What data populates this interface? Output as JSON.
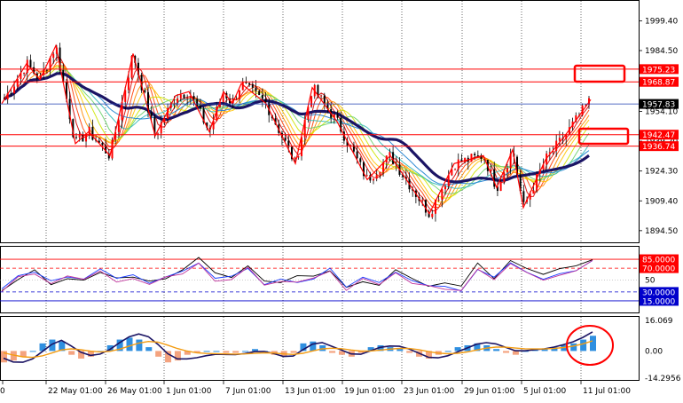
{
  "colors": {
    "bg": "#ffffff",
    "frame": "#000000",
    "grid": "#000000",
    "candle": "#000000",
    "bull_candle": "#ff0000",
    "zigzag": "#ff0000",
    "hline": "#ff0000",
    "bid_line": "#1f3fb0",
    "sma_heavy": "#1b1464",
    "fan": [
      "#d60000",
      "#ff3b00",
      "#ff8a00",
      "#ffc400",
      "#cde600",
      "#6ad06a",
      "#2fb8b8",
      "#1b7fd0"
    ],
    "osc_black": "#000000",
    "osc_blue": "#1a3cff",
    "osc_magenta": "#c0329b",
    "level_red": "#ff0000",
    "level_blue": "#0000cc",
    "hist_pos": "#2f8fe0",
    "hist_neg": "#f4a37f",
    "macd_line": "#1b1464",
    "signal_line": "#f39c12",
    "annot": "#ff0000"
  },
  "price_panel": {
    "axis_labels": [
      "1999.40",
      "1984.50",
      "1954.10",
      "1939.20",
      "1924.30",
      "1909.40",
      "1894.50"
    ],
    "axis_values": [
      1999.4,
      1984.5,
      1954.1,
      1939.2,
      1924.3,
      1909.4,
      1894.5
    ],
    "ylim": [
      1890.0,
      2008.0
    ],
    "current_price": "1957.83",
    "levels": [
      {
        "label": "1975.23",
        "value": 1975.23
      },
      {
        "label": "1968.87",
        "value": 1968.87
      },
      {
        "label": "1942.47",
        "value": 1942.47
      },
      {
        "label": "1936.74",
        "value": 1936.74
      }
    ]
  },
  "oscillator_panel": {
    "levels": [
      {
        "label": "85.0000",
        "value": 85,
        "style": "red"
      },
      {
        "label": "70.0000",
        "value": 70,
        "style": "red-dash"
      },
      {
        "label": "30.0000",
        "value": 30,
        "style": "blue-dash"
      },
      {
        "label": "15.0000",
        "value": 15,
        "style": "blue"
      }
    ],
    "mid_label": "50",
    "mid_value": 50,
    "ylim": [
      0,
      100
    ]
  },
  "macd_panel": {
    "axis_labels": [
      "16.069",
      "0.00",
      "-14.2956"
    ],
    "axis_values": [
      16.069,
      0,
      -14.2956
    ],
    "ylim": [
      -14.2956,
      16.069
    ]
  },
  "x_axis": {
    "labels": [
      "0",
      "22 May 01:00",
      "26 May 01:00",
      "1 Jun 01:00",
      "7 Jun 01:00",
      "13 Jun 01:00",
      "19 Jun 01:00",
      "23 Jun 01:00",
      "29 Jun 01:00",
      "5 Jul 01:00",
      "11 Jul 01:00"
    ]
  },
  "chart_data": [
    {
      "type": "line",
      "panel": "price",
      "title": "",
      "x": [
        "18 May",
        "22 May",
        "26 May",
        "1 Jun",
        "7 Jun",
        "13 Jun",
        "19 Jun",
        "23 Jun",
        "29 Jun",
        "5 Jul",
        "11 Jul"
      ],
      "series": [
        {
          "values": [
            1975,
            1968,
            1956,
            1958,
            1955,
            1953,
            1946,
            1926,
            1919,
            1920,
            1935
          ]
        }
      ],
      "zigzag_points": [
        {
          "x": "18 May",
          "y": 1958
        },
        {
          "x": "20 May",
          "y": 1978
        },
        {
          "x": "22 May",
          "y": 1970
        },
        {
          "x": "24 May",
          "y": 1987
        },
        {
          "x": "26 May",
          "y": 1938
        },
        {
          "x": "27 May",
          "y": 1944
        },
        {
          "x": "28 May",
          "y": 1932
        },
        {
          "x": "31 May",
          "y": 1983
        },
        {
          "x": "2 Jun",
          "y": 1942
        },
        {
          "x": "4 Jun",
          "y": 1962
        },
        {
          "x": "5 Jun",
          "y": 1964
        },
        {
          "x": "6 Jun",
          "y": 1944
        },
        {
          "x": "8 Jun",
          "y": 1964
        },
        {
          "x": "9 Jun",
          "y": 1958
        },
        {
          "x": "10 Jun",
          "y": 1968
        },
        {
          "x": "12 Jun",
          "y": 1958
        },
        {
          "x": "15 Jun",
          "y": 1928
        },
        {
          "x": "17 Jun",
          "y": 1966
        },
        {
          "x": "20 Jun",
          "y": 1949
        },
        {
          "x": "23 Jun",
          "y": 1920
        },
        {
          "x": "25 Jun",
          "y": 1932
        },
        {
          "x": "28 Jun",
          "y": 1903
        },
        {
          "x": "1 Jul",
          "y": 1928
        },
        {
          "x": "2 Jul",
          "y": 1932
        },
        {
          "x": "3 Jul",
          "y": 1916
        },
        {
          "x": "4 Jul",
          "y": 1935
        },
        {
          "x": "6 Jul",
          "y": 1906
        },
        {
          "x": "8 Jul",
          "y": 1930
        },
        {
          "x": "10 Jul",
          "y": 1942
        },
        {
          "x": "11 Jul",
          "y": 1960
        }
      ],
      "ylim": [
        1890.0,
        2008.0
      ]
    },
    {
      "type": "line",
      "panel": "oscillator",
      "title": "",
      "series": [
        {
          "values": [
            35,
            58,
            64,
            48,
            60,
            56,
            70,
            52,
            58,
            48,
            60,
            65,
            82,
            54,
            56,
            74,
            46,
            52,
            50,
            56,
            70,
            38,
            55,
            48,
            65,
            50,
            45,
            40,
            36,
            72,
            55,
            80,
            68,
            55,
            62,
            70,
            86
          ]
        }
      ],
      "ylim": [
        0,
        100
      ]
    },
    {
      "type": "bar",
      "panel": "macd",
      "title": "",
      "values": [
        -6,
        -5,
        -3,
        0,
        4,
        6,
        5,
        -2,
        -4,
        -3,
        0,
        3,
        6,
        7,
        6,
        2,
        -3,
        -6,
        -5,
        -2,
        -1,
        0,
        0,
        -1,
        -1,
        0,
        1,
        0,
        -2,
        -3,
        -1,
        4,
        5,
        3,
        -1,
        -2,
        -3,
        -1,
        2,
        3,
        2,
        1,
        -1,
        -3,
        -4,
        -2,
        0,
        2,
        3,
        4,
        3,
        1,
        -1,
        -2,
        0,
        1,
        1,
        2,
        3,
        4,
        6,
        8
      ],
      "ylim": [
        -14.2956,
        16.069
      ]
    }
  ]
}
